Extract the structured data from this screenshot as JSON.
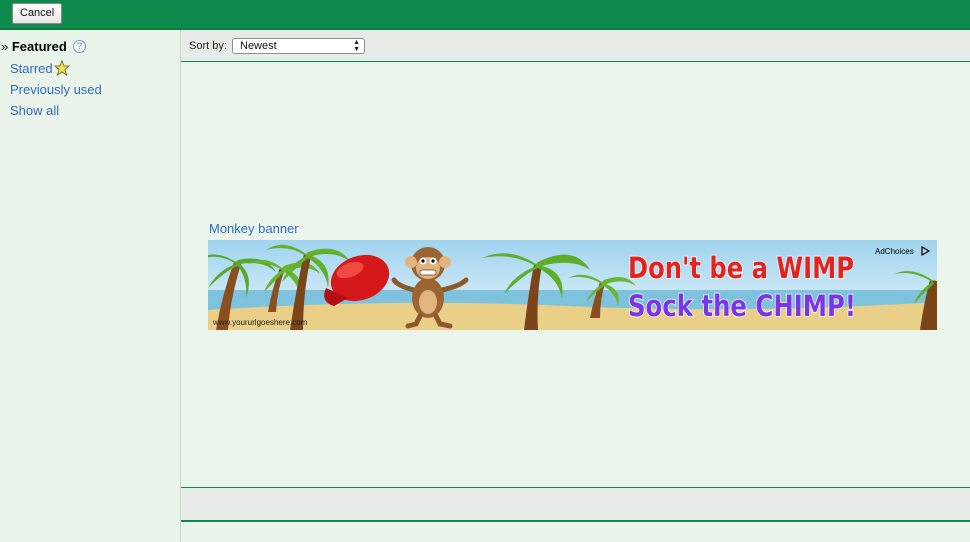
{
  "toolbar": {
    "cancel_label": "Cancel"
  },
  "sidebar": {
    "featured_prefix": "»",
    "featured_label": "Featured",
    "help_glyph": "?",
    "items": [
      {
        "label": "Starred",
        "icon": "star-icon"
      },
      {
        "label": "Previously used"
      },
      {
        "label": "Show all"
      }
    ]
  },
  "sort": {
    "label": "Sort by:",
    "selected": "Newest"
  },
  "banner": {
    "title": "Monkey banner",
    "headline_line1": "Don't be a WIMP",
    "headline_line2": "Sock the CHIMP!",
    "url_text": "www.yoururlgoeshere.com",
    "adchoices": "AdChoices",
    "colors": {
      "line1": "#e4231f",
      "line2": "#7b35e8",
      "sky": "#bfe3f5",
      "sand": "#e9cf88"
    }
  }
}
